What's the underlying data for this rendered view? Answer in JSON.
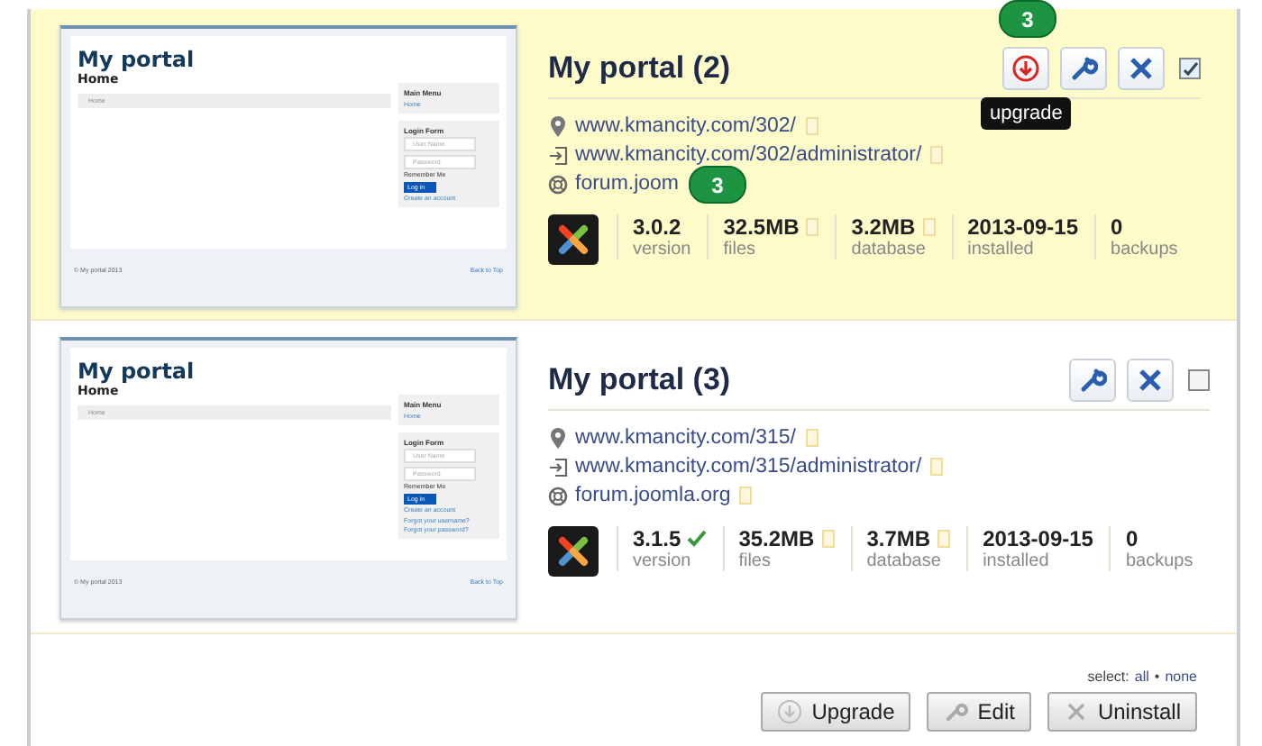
{
  "sites": [
    {
      "highlighted": true,
      "selected": true,
      "title": "My portal (2)",
      "thumbnail": {
        "title": "My portal",
        "heading": "Home",
        "breadcrumb": "Home",
        "menu_title": "Main Menu",
        "menu_items": [
          "Home"
        ],
        "login_title": "Login Form",
        "username_placeholder": "User Name",
        "password_placeholder": "Password",
        "remember": "Remember Me",
        "login_button": "Log in",
        "account_links": [
          "Create an account"
        ],
        "footer": "© My portal 2013",
        "back_to_top": "Back to Top"
      },
      "upgrade": {
        "callout": "3",
        "tooltip": "upgrade"
      },
      "links": [
        {
          "kind": "site",
          "text": "www.kmancity.com/302/"
        },
        {
          "kind": "admin",
          "text": "www.kmancity.com/302/administrator/"
        },
        {
          "kind": "forum",
          "text": "forum.joom",
          "callout": "3"
        }
      ],
      "stats": [
        {
          "kind": "version",
          "value": "3.0.2",
          "label": "version",
          "current": false
        },
        {
          "kind": "size",
          "value": "32.5MB",
          "label": "files"
        },
        {
          "kind": "size",
          "value": "3.2MB",
          "label": "database"
        },
        {
          "kind": "plain",
          "value": "2013-09-15",
          "label": "installed"
        },
        {
          "kind": "plain",
          "value": "0",
          "label": "backups"
        }
      ]
    },
    {
      "highlighted": false,
      "selected": false,
      "title": "My portal (3)",
      "thumbnail": {
        "title": "My portal",
        "heading": "Home",
        "breadcrumb": "Home",
        "menu_title": "Main Menu",
        "menu_items": [
          "Home"
        ],
        "login_title": "Login Form",
        "username_placeholder": "User Name",
        "password_placeholder": "Password",
        "remember": "Remember Me",
        "login_button": "Log in",
        "account_links": [
          "Create an account",
          "Forgot your username?",
          "Forgot your password?"
        ],
        "footer": "© My portal 2013",
        "back_to_top": "Back to Top"
      },
      "links": [
        {
          "kind": "site",
          "text": "www.kmancity.com/315/"
        },
        {
          "kind": "admin",
          "text": "www.kmancity.com/315/administrator/"
        },
        {
          "kind": "forum",
          "text": "forum.joomla.org"
        }
      ],
      "stats": [
        {
          "kind": "version",
          "value": "3.1.5",
          "label": "version",
          "current": true
        },
        {
          "kind": "size",
          "value": "35.2MB",
          "label": "files"
        },
        {
          "kind": "size",
          "value": "3.7MB",
          "label": "database"
        },
        {
          "kind": "plain",
          "value": "2013-09-15",
          "label": "installed"
        },
        {
          "kind": "plain",
          "value": "0",
          "label": "backups"
        }
      ]
    }
  ],
  "select": {
    "label": "select:",
    "all": "all",
    "separator": "•",
    "none": "none"
  },
  "actions": [
    {
      "kind": "upgrade",
      "label": "Upgrade"
    },
    {
      "kind": "edit",
      "label": "Edit"
    },
    {
      "kind": "uninstall",
      "label": "Uninstall"
    }
  ]
}
